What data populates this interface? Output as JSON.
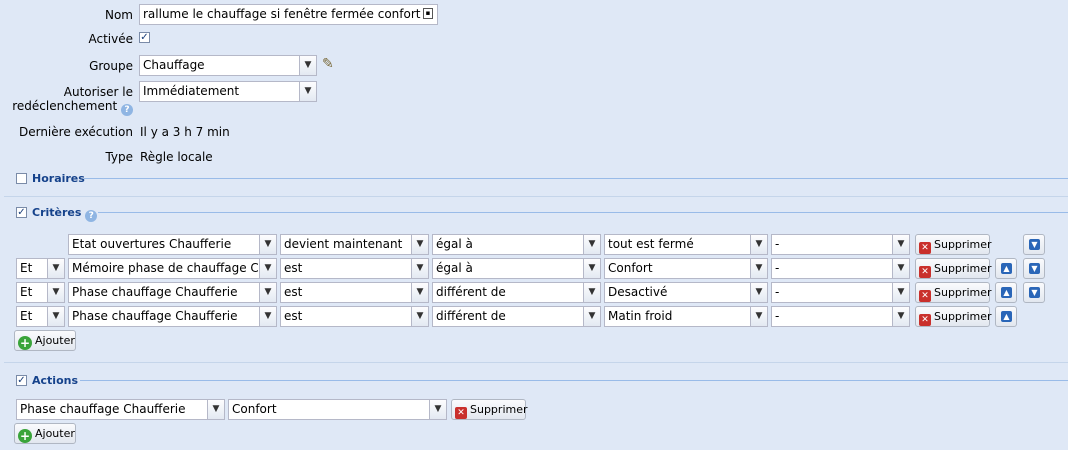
{
  "form": {
    "nom_label": "Nom",
    "nom_value": "rallume le chauffage si fenêtre fermée confort",
    "activee_label": "Activée",
    "groupe_label": "Groupe",
    "groupe_value": "Chauffage",
    "autoriser_label_1": "Autoriser le",
    "autoriser_label_2": "redéclenchement",
    "autoriser_value": "Immédiatement",
    "derniere_label": "Dernière exécution",
    "derniere_value": "Il y a 3 h 7 min",
    "type_label": "Type",
    "type_value": "Règle locale"
  },
  "sections": {
    "horaires": "Horaires",
    "criteres": "Critères",
    "actions": "Actions"
  },
  "criteria": [
    {
      "conj": "",
      "item": "Etat ouvertures Chaufferie",
      "cond": "devient maintenant",
      "op": "égal à",
      "value": "tout est fermé",
      "extra": "-",
      "delete": "Supprimer",
      "up": false,
      "down": true
    },
    {
      "conj": "Et",
      "item": "Mémoire phase de chauffage Chaufferie",
      "cond": "est",
      "op": "égal à",
      "value": "Confort",
      "extra": "-",
      "delete": "Supprimer",
      "up": true,
      "down": true
    },
    {
      "conj": "Et",
      "item": "Phase chauffage Chaufferie",
      "cond": "est",
      "op": "différent de",
      "value": "Desactivé",
      "extra": "-",
      "delete": "Supprimer",
      "up": true,
      "down": true
    },
    {
      "conj": "Et",
      "item": "Phase chauffage Chaufferie",
      "cond": "est",
      "op": "différent de",
      "value": "Matin froid",
      "extra": "-",
      "delete": "Supprimer",
      "up": true,
      "down": false
    }
  ],
  "criteria_add": "Ajouter",
  "actions": [
    {
      "item": "Phase chauffage Chaufferie",
      "value": "Confort",
      "delete": "Supprimer"
    }
  ],
  "actions_add": "Ajouter",
  "icons": {
    "checkbox_checked": "checkbox-checked-icon",
    "dropdown": "chevron-down-icon",
    "help": "help-icon",
    "edit": "pencil-icon",
    "delete": "delete-icon",
    "add": "add-icon",
    "up": "arrow-up-icon",
    "down": "arrow-down-icon",
    "contact": "contact-card-icon"
  },
  "colors": {
    "background": "#dfe8f6",
    "section_title": "#15428b",
    "delete_icon": "#c9302c",
    "add_icon": "#3aa43a",
    "arrow_icon": "#2a66b8"
  }
}
